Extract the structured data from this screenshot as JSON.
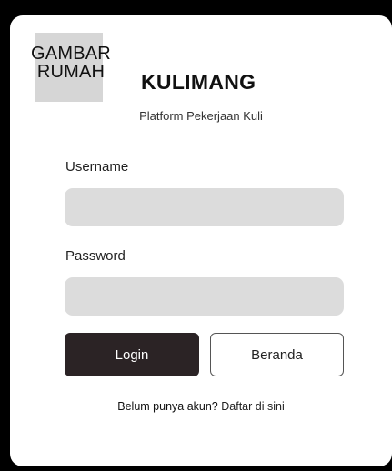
{
  "logo": {
    "line1": "GAMBAR",
    "line2": "RUMAH"
  },
  "brand": {
    "name": "KULIMANG",
    "tagline": "Platform Pekerjaan Kuli"
  },
  "form": {
    "username_label": "Username",
    "username_value": "",
    "password_label": "Password",
    "password_value": "",
    "login_label": "Login",
    "home_label": "Beranda"
  },
  "register": {
    "prompt": "Belum punya akun?",
    "link": "Daftar di sini"
  },
  "colors": {
    "background": "#000000",
    "card": "#ffffff",
    "input_fill": "#dcdcdc",
    "primary_button": "#2b2325",
    "logo_placeholder": "#d6d6d6"
  }
}
